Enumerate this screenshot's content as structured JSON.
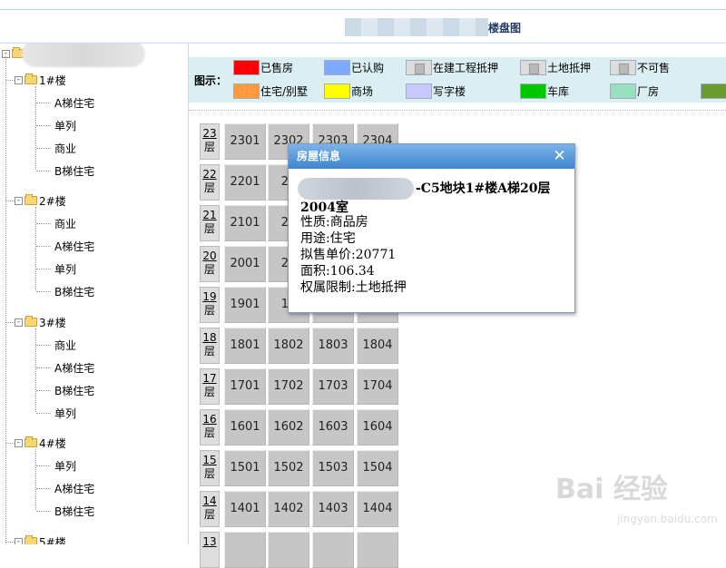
{
  "header": {
    "title": "楼盘图"
  },
  "tree": {
    "expander_minus": "-",
    "buildings": [
      {
        "label": "1#楼",
        "children": [
          "A梯住宅",
          "单列",
          "商业",
          "B梯住宅"
        ]
      },
      {
        "label": "2#楼",
        "children": [
          "商业",
          "A梯住宅",
          "单列",
          "B梯住宅"
        ]
      },
      {
        "label": "3#楼",
        "children": [
          "商业",
          "A梯住宅",
          "B梯住宅",
          "单列"
        ]
      },
      {
        "label": "4#楼",
        "children": [
          "单列",
          "A梯住宅",
          "B梯住宅"
        ]
      },
      {
        "label": "5#楼",
        "children": []
      }
    ]
  },
  "legend": {
    "title": "图示：",
    "items": [
      {
        "label": "已售房",
        "color": "#ff0000"
      },
      {
        "label": "已认购",
        "color": "#7fa8ff"
      },
      {
        "label": "在建工程抵押",
        "color": "#dcdcdc",
        "icon": "document-icon"
      },
      {
        "label": "土地抵押",
        "color": "#dcdcdc",
        "icon": "document-icon"
      },
      {
        "label": "不可售",
        "color": "#dcdcdc",
        "icon": "lock-icon"
      },
      {
        "label": "住宅/别墅",
        "color": "#ff9a40"
      },
      {
        "label": "商场",
        "color": "#ffff00"
      },
      {
        "label": "写字楼",
        "color": "#c8c8ff"
      },
      {
        "label": "车库",
        "color": "#00c800"
      },
      {
        "label": "厂房",
        "color": "#99e0c0"
      },
      {
        "label": "",
        "color": "#6a9a30"
      }
    ]
  },
  "floors": [
    {
      "label": "23",
      "suffix": "层",
      "units": [
        "2301",
        "2302",
        "2303",
        "2304"
      ]
    },
    {
      "label": "22",
      "suffix": "层",
      "units": [
        "2201",
        "22",
        "",
        ""
      ]
    },
    {
      "label": "21",
      "suffix": "层",
      "units": [
        "2101",
        "21",
        "",
        ""
      ]
    },
    {
      "label": "20",
      "suffix": "层",
      "units": [
        "2001",
        "20",
        "",
        ""
      ]
    },
    {
      "label": "19",
      "suffix": "层",
      "units": [
        "1901",
        "19",
        "",
        ""
      ]
    },
    {
      "label": "18",
      "suffix": "层",
      "units": [
        "1801",
        "1802",
        "1803",
        "1804"
      ]
    },
    {
      "label": "17",
      "suffix": "层",
      "units": [
        "1701",
        "1702",
        "1703",
        "1704"
      ]
    },
    {
      "label": "16",
      "suffix": "层",
      "units": [
        "1601",
        "1602",
        "1603",
        "1604"
      ]
    },
    {
      "label": "15",
      "suffix": "层",
      "units": [
        "1501",
        "1502",
        "1503",
        "1504"
      ]
    },
    {
      "label": "14",
      "suffix": "层",
      "units": [
        "1401",
        "1402",
        "1403",
        "1404"
      ]
    },
    {
      "label": "13",
      "suffix": "",
      "units": [
        "",
        "",
        "",
        ""
      ]
    }
  ],
  "dialog": {
    "title": "房屋信息",
    "close": "✕",
    "line1": "-C5地块1#楼A梯20层",
    "line2": "2004室",
    "info": [
      "性质:商品房",
      "用途:住宅",
      "拟售单价:20771",
      "面积:106.34",
      "权属限制:土地抵押"
    ]
  },
  "watermark": {
    "text": "Bai 经验",
    "url": "jingyan.baidu.com"
  }
}
